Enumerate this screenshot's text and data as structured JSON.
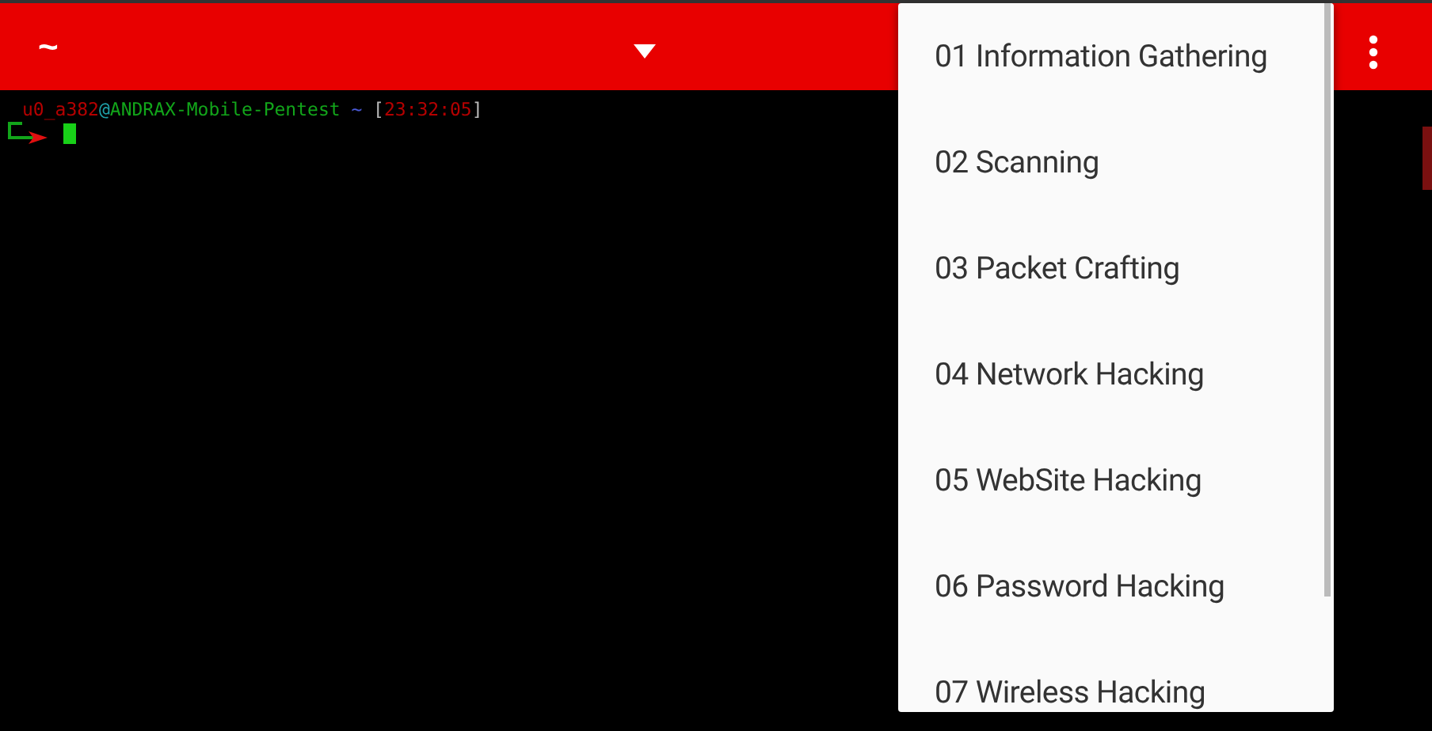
{
  "toolbar": {
    "title": "~"
  },
  "terminal": {
    "prompt_segments": [
      {
        "text": "u0_a382",
        "color": "#b40000"
      },
      {
        "text": "@",
        "color": "#1fa0a8"
      },
      {
        "text": "ANDRAX-Mobile-Pentest",
        "color": "#12a51a"
      },
      {
        "text": "~",
        "color": "#4a5ad8",
        "spaced": true
      },
      {
        "text": "[",
        "color": "#b8b8b8",
        "spaced": true
      },
      {
        "text": "23:32:05",
        "color": "#b40000"
      },
      {
        "text": "]",
        "color": "#b8b8b8"
      }
    ]
  },
  "menu": {
    "items": [
      {
        "label": "01 Information Gathering"
      },
      {
        "label": "02 Scanning"
      },
      {
        "label": "03 Packet Crafting"
      },
      {
        "label": "04 Network Hacking"
      },
      {
        "label": "05 WebSite Hacking"
      },
      {
        "label": "06 Password Hacking"
      },
      {
        "label": "07 Wireless Hacking"
      }
    ]
  }
}
